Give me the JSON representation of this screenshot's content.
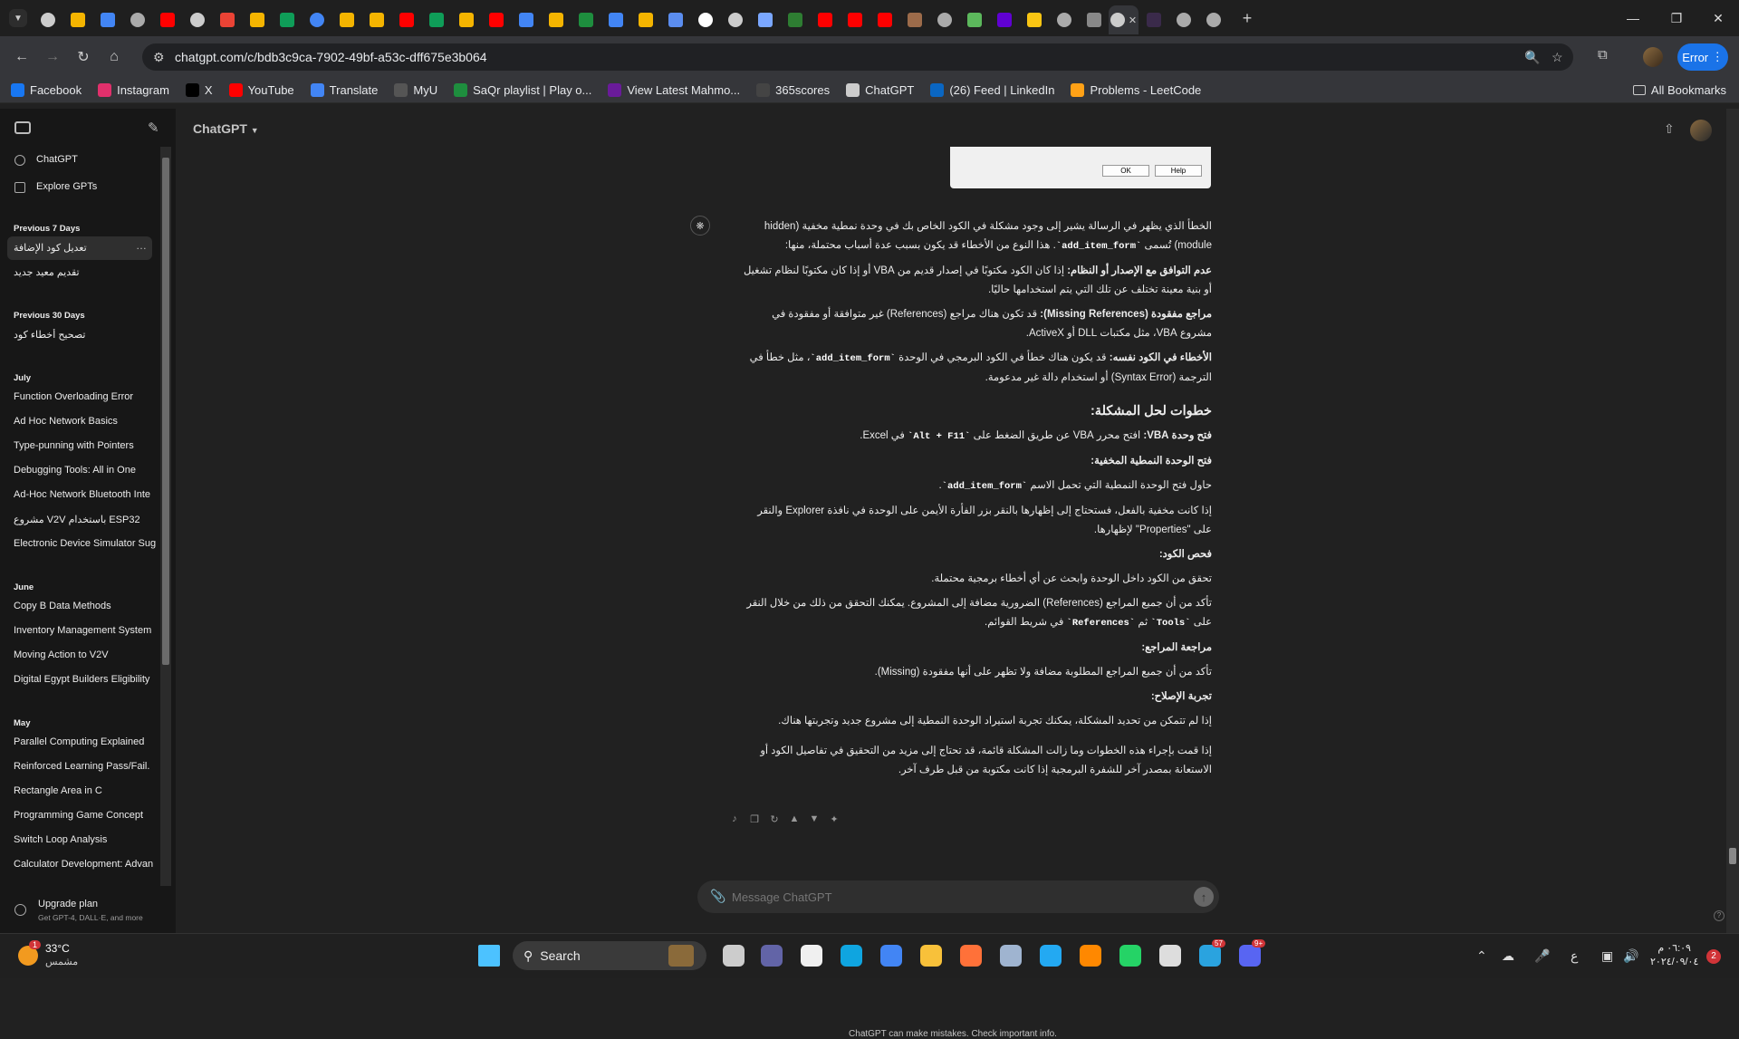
{
  "browser": {
    "tabs": [
      {
        "icon": "chatgpt-icon",
        "color": "#cccccc"
      },
      {
        "icon": "drive-icon",
        "color": "#f4b400"
      },
      {
        "icon": "docs-icon",
        "color": "#4285f4"
      },
      {
        "icon": "globe-icon",
        "color": "#aaaaaa"
      },
      {
        "icon": "youtube-icon",
        "color": "#ff0000"
      },
      {
        "icon": "chatgpt-icon",
        "color": "#cccccc"
      },
      {
        "icon": "gmail-icon",
        "color": "#ea4335"
      },
      {
        "icon": "drive-icon",
        "color": "#f4b400"
      },
      {
        "icon": "drive-icon",
        "color": "#0f9d58"
      },
      {
        "icon": "google-icon",
        "color": "#4285f4"
      },
      {
        "icon": "drive-icon",
        "color": "#f4b400"
      },
      {
        "icon": "drive-icon",
        "color": "#f4b400"
      },
      {
        "icon": "youtube-icon",
        "color": "#ff0000"
      },
      {
        "icon": "drive-icon",
        "color": "#0f9d58"
      },
      {
        "icon": "drive-icon",
        "color": "#f4b400"
      },
      {
        "icon": "youtube-icon",
        "color": "#ff0000"
      },
      {
        "icon": "docs-icon",
        "color": "#4285f4"
      },
      {
        "icon": "drive-icon",
        "color": "#f4b400"
      },
      {
        "icon": "circle-icon",
        "color": "#1e8e3e"
      },
      {
        "icon": "docs-icon",
        "color": "#4285f4"
      },
      {
        "icon": "slides-icon",
        "color": "#f4b400"
      },
      {
        "icon": "chat-icon",
        "color": "#5b8def"
      },
      {
        "icon": "google-icon",
        "color": "#ffffff"
      },
      {
        "icon": "chatgpt-icon",
        "color": "#cccccc"
      },
      {
        "icon": "gemini-icon",
        "color": "#7aa7ff"
      },
      {
        "icon": "w-icon",
        "color": "#2e7d32"
      },
      {
        "icon": "youtube-icon",
        "color": "#ff0000"
      },
      {
        "icon": "youtube-icon",
        "color": "#ff0000"
      },
      {
        "icon": "youtube-icon",
        "color": "#ff0000"
      },
      {
        "icon": "image-icon",
        "color": "#9c6b4a"
      },
      {
        "icon": "globe-icon",
        "color": "#aaaaaa"
      },
      {
        "icon": "leaf-icon",
        "color": "#5cb85c"
      },
      {
        "icon": "yahoo-icon",
        "color": "#6001d2"
      },
      {
        "icon": "note-icon",
        "color": "#f9c513"
      },
      {
        "icon": "globe-icon",
        "color": "#aaaaaa"
      },
      {
        "icon": "media-icon",
        "color": "#888888"
      },
      {
        "icon": "chatgpt-icon",
        "color": "#cccccc",
        "active": true
      },
      {
        "icon": "dark-icon",
        "color": "#3a2a4a"
      },
      {
        "icon": "globe-icon",
        "color": "#aaaaaa"
      },
      {
        "icon": "globe-icon",
        "color": "#aaaaaa"
      }
    ],
    "url": "chatgpt.com/c/bdb3c9ca-7902-49bf-a53c-dff675e3b064",
    "profile_button": "Error",
    "bookmarks": [
      {
        "label": "Facebook",
        "icon": "facebook-icon",
        "color": "#1877f2"
      },
      {
        "label": "Instagram",
        "icon": "instagram-icon",
        "color": "#e1306c"
      },
      {
        "label": "X",
        "icon": "x-icon",
        "color": "#000000"
      },
      {
        "label": "YouTube",
        "icon": "youtube-icon",
        "color": "#ff0000"
      },
      {
        "label": "Translate",
        "icon": "translate-icon",
        "color": "#4285f4"
      },
      {
        "label": "MyU",
        "icon": "myu-icon",
        "color": "#555555"
      },
      {
        "label": "SaQr playlist | Play o...",
        "icon": "circle-icon",
        "color": "#1e8e3e"
      },
      {
        "label": "View Latest Mahmo...",
        "icon": "purple-icon",
        "color": "#6a1b9a"
      },
      {
        "label": "365scores",
        "icon": "score-icon",
        "color": "#444444"
      },
      {
        "label": "ChatGPT",
        "icon": "chatgpt-icon",
        "color": "#cccccc"
      },
      {
        "label": "(26) Feed | LinkedIn",
        "icon": "linkedin-icon",
        "color": "#0a66c2"
      },
      {
        "label": "Problems - LeetCode",
        "icon": "leetcode-icon",
        "color": "#ffa116"
      }
    ],
    "all_bookmarks": "All Bookmarks"
  },
  "sidebar": {
    "top_items": [
      {
        "label": "ChatGPT",
        "icon": "chatgpt-icon"
      },
      {
        "label": "Explore GPTs",
        "icon": "grid-icon"
      }
    ],
    "sections": [
      {
        "heading": "Previous 7 Days",
        "items": [
          "تعديل كود الإضافة",
          "تقديم معيد جديد"
        ]
      },
      {
        "heading": "Previous 30 Days",
        "items": [
          "تصحيح أخطاء كود"
        ]
      },
      {
        "heading": "July",
        "items": [
          "Function Overloading Error",
          "Ad Hoc Network Basics",
          "Type-punning with Pointers",
          "Debugging Tools: All in One",
          "Ad-Hoc Network Bluetooth Inte",
          "مشروع V2V باستخدام ESP32",
          "Electronic Device Simulator Sug"
        ]
      },
      {
        "heading": "June",
        "items": [
          "Copy B Data Methods",
          "Inventory Management System",
          "Moving Action to V2V",
          "Digital Egypt Builders Eligibility"
        ]
      },
      {
        "heading": "May",
        "items": [
          "Parallel Computing Explained",
          "Reinforced Learning Pass/Fail.",
          "Rectangle Area in C",
          "Programming Game Concept",
          "Switch Loop Analysis",
          "Calculator Development: Advan"
        ]
      }
    ],
    "upgrade_title": "Upgrade plan",
    "upgrade_sub": "Get GPT-4, DALL·E, and more"
  },
  "header": {
    "model": "ChatGPT"
  },
  "dialog": {
    "ok": "OK",
    "help": "Help"
  },
  "answer": {
    "intro_1": "الخطأ الذي يظهر في الرسالة يشير إلى وجود مشكلة في الكود الخاص بك في وحدة نمطية مخفية (hidden module) تُسمى ",
    "intro_code": "`add_item_form`",
    "intro_2": ". هذا النوع من الأخطاء قد يكون بسبب عدة أسباب محتملة، منها:",
    "c1_title": "عدم التوافق مع الإصدار أو النظام:",
    "c1_text": " إذا كان الكود مكتوبًا في إصدار قديم من VBA أو إذا كان مكتوبًا لنظام تشغيل أو بنية معينة تختلف عن تلك التي يتم استخدامها حاليًا.",
    "c2_title": "مراجع مفقودة (Missing References):",
    "c2_text": " قد تكون هناك مراجع (References) غير متوافقة أو مفقودة في مشروع VBA، مثل مكتبات DLL أو ActiveX.",
    "c3_title": "الأخطاء في الكود نفسه:",
    "c3_text_1": " قد يكون هناك خطأ في الكود البرمجي في الوحدة ",
    "c3_code": "`add_item_form`",
    "c3_text_2": "، مثل خطأ في الترجمة (Syntax Error) أو استخدام دالة غير مدعومة.",
    "steps_heading": "خطوات لحل المشكلة:",
    "s1_title": "فتح وحدة VBA:",
    "s1_text_1": " افتح محرر VBA عن طريق الضغط على ",
    "s1_code": "`Alt + F11`",
    "s1_text_2": " في Excel.",
    "s2_title": "فتح الوحدة النمطية المخفية:",
    "s2_a_1": "حاول فتح الوحدة النمطية التي تحمل الاسم ",
    "s2_a_code": "`add_item_form`",
    "s2_a_2": ".",
    "s2_b": "إذا كانت مخفية بالفعل، فستحتاج إلى إظهارها بالنقر بزر الفأرة الأيمن على الوحدة في نافذة Explorer والنقر على \"Properties\" لإظهارها.",
    "s3_title": "فحص الكود:",
    "s3_a": "تحقق من الكود داخل الوحدة وابحث عن أي أخطاء برمجية محتملة.",
    "s3_b_1": "تأكد من أن جميع المراجع (References) الضرورية مضافة إلى المشروع. يمكنك التحقق من ذلك من خلال النقر على ",
    "s3_b_code1": "`Tools`",
    "s3_b_2": " ثم ",
    "s3_b_code2": "`References`",
    "s3_b_3": " في شريط القوائم.",
    "s4_title": "مراجعة المراجع:",
    "s4_a": "تأكد من أن جميع المراجع المطلوبة مضافة ولا تظهر على أنها مفقودة (Missing).",
    "s5_title": "تجربة الإصلاح:",
    "s5_a": "إذا لم تتمكن من تحديد المشكلة، يمكنك تجربة استيراد الوحدة النمطية إلى مشروع جديد وتجربتها هناك.",
    "outro": "إذا قمت بإجراء هذه الخطوات وما زالت المشكلة قائمة، قد تحتاج إلى مزيد من التحقيق في تفاصيل الكود أو الاستعانة بمصدر آخر للشفرة البرمجية إذا كانت مكتوبة من قبل طرف آخر."
  },
  "composer": {
    "placeholder": "Message ChatGPT"
  },
  "disclaimer": "ChatGPT can make mistakes. Check important info.",
  "taskbar": {
    "temp": "33°C",
    "condition": "مشمس",
    "weather_badge": "1",
    "search": "Search",
    "apps": [
      {
        "icon": "windows-icon",
        "color": "#4cc2ff"
      },
      {
        "icon": "taskview-icon",
        "color": "#cccccc"
      },
      {
        "icon": "teams-icon",
        "color": "#6264a7"
      },
      {
        "icon": "store-icon",
        "color": "#f0f0f0"
      },
      {
        "icon": "edge-icon",
        "color": "#0fa5e0"
      },
      {
        "icon": "chrome-icon",
        "color": "#4285f4"
      },
      {
        "icon": "explorer-icon",
        "color": "#f8c13a"
      },
      {
        "icon": "firefox-icon",
        "color": "#ff7139"
      },
      {
        "icon": "settings-icon",
        "color": "#9fb4d0"
      },
      {
        "icon": "vscode-icon",
        "color": "#23a9f2"
      },
      {
        "icon": "vlc-icon",
        "color": "#ff8800"
      },
      {
        "icon": "whatsapp-icon",
        "color": "#25d366"
      },
      {
        "icon": "gear-app-icon",
        "color": "#dddddd"
      },
      {
        "icon": "telegram-icon",
        "color": "#2aa3df"
      },
      {
        "icon": "discord-icon",
        "color": "#5865f2"
      }
    ],
    "telegram_badge": "57",
    "discord_badge": "9+",
    "lang": "ع",
    "time": "٠٦:٠٩ م",
    "date": "٢٠٢٤/٠٩/٠٤",
    "notif": "2"
  }
}
